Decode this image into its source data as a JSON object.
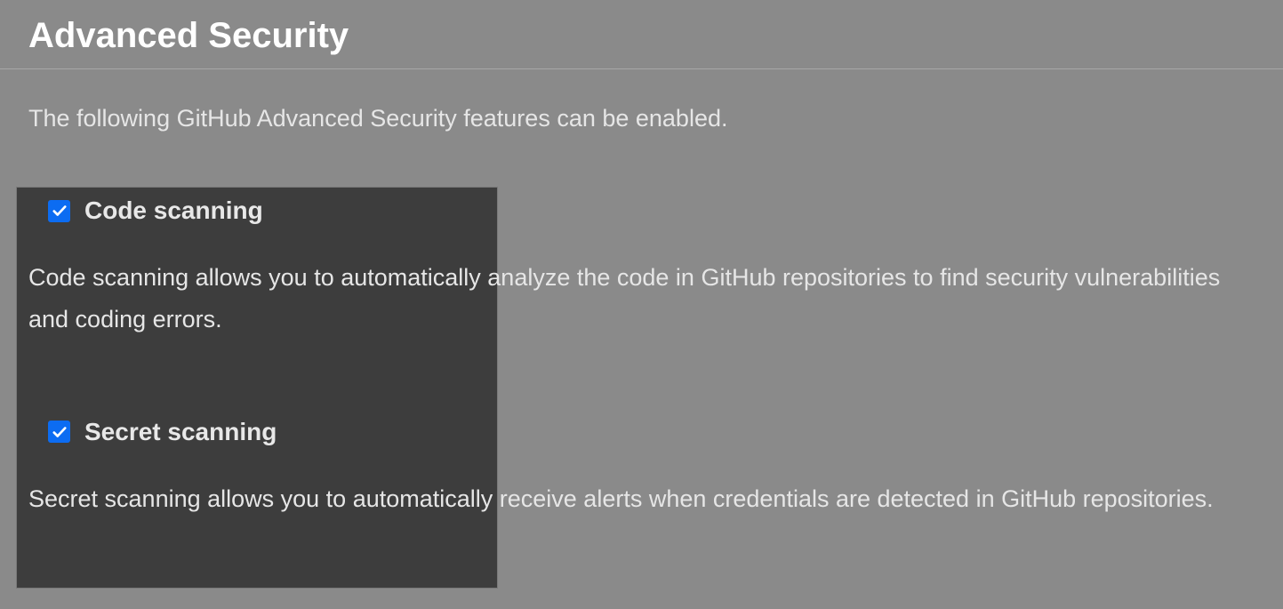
{
  "page": {
    "title": "Advanced Security",
    "intro": "The following GitHub Advanced Security features can be enabled."
  },
  "features": [
    {
      "label": "Code scanning",
      "checked": true,
      "description": "Code scanning allows you to automatically analyze the code in GitHub repositories to find security vulnerabilities and coding errors."
    },
    {
      "label": "Secret scanning",
      "checked": true,
      "description": "Secret scanning allows you to automatically receive alerts when credentials are detected in GitHub repositories."
    }
  ]
}
